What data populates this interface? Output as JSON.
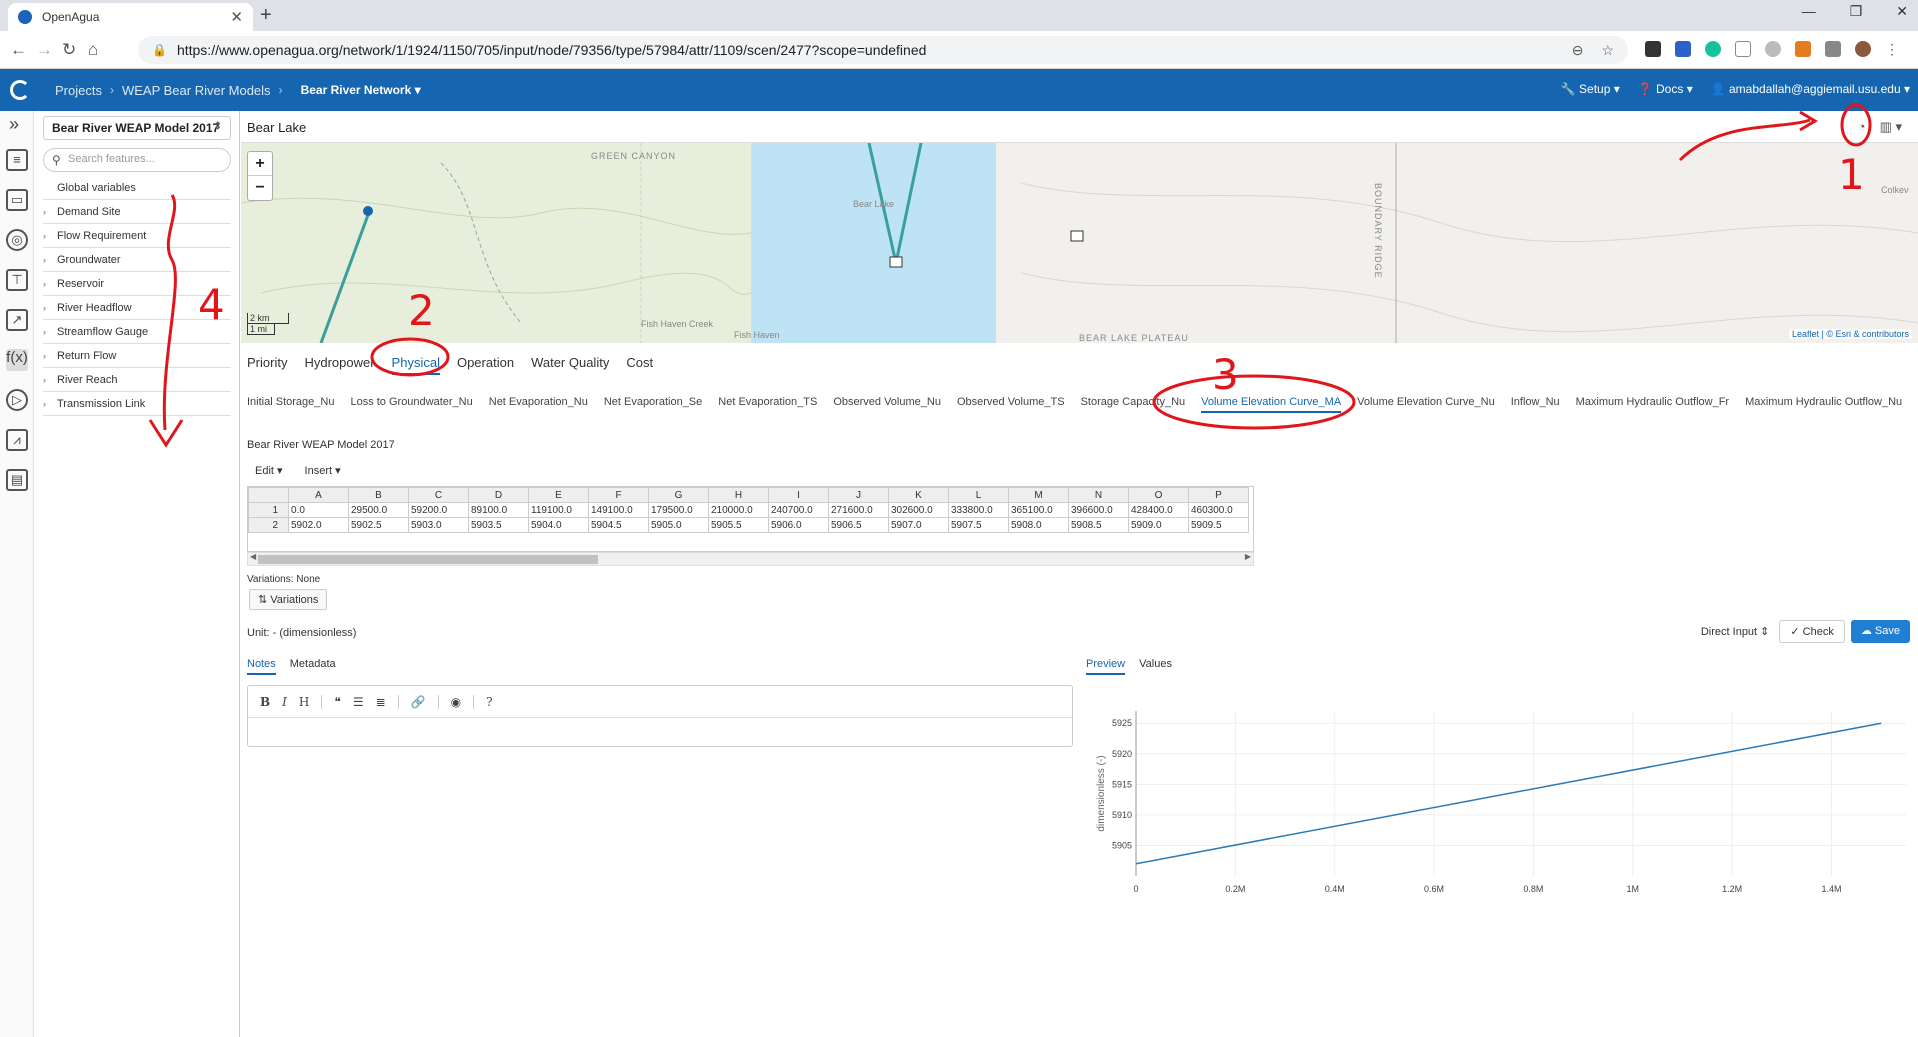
{
  "browser": {
    "tab_title": "OpenAgua",
    "url": "https://www.openagua.org/network/1/1924/1150/705/input/node/79356/type/57984/attr/1109/scen/2477?scope=undefined"
  },
  "header": {
    "crumbs": [
      "Projects",
      "WEAP Bear River Models"
    ],
    "active": "Bear River Network",
    "setup": "Setup",
    "docs": "Docs",
    "user": "amabdallah@aggiemail.usu.edu"
  },
  "features": {
    "model": "Bear River WEAP Model 2017",
    "search_placeholder": "Search features...",
    "items": [
      "Global variables",
      "Demand Site",
      "Flow Requirement",
      "Groundwater",
      "Reservoir",
      "River Headflow",
      "Streamflow Gauge",
      "Return Flow",
      "River Reach",
      "Transmission Link"
    ]
  },
  "main": {
    "title": "Bear Lake",
    "map": {
      "labels": [
        "GREEN CANYON",
        "Bear Lake",
        "Fish Haven",
        "Fish Haven Creek",
        "BEAR LAKE PLATEAU",
        "BOUNDARY RIDGE",
        "Colkev"
      ],
      "scale_km": "2 km",
      "scale_mi": "1 mi",
      "attribution": "Leaflet | © Esri & contributors"
    },
    "tabs": [
      "Priority",
      "Hydropower",
      "Physical",
      "Operation",
      "Water Quality",
      "Cost"
    ],
    "active_tab": "Physical",
    "attributes": [
      "Initial Storage_Nu",
      "Loss to Groundwater_Nu",
      "Net Evaporation_Nu",
      "Net Evaporation_Se",
      "Net Evaporation_TS",
      "Observed Volume_Nu",
      "Observed Volume_TS",
      "Storage Capacity_Nu",
      "Volume Elevation Curve_MA",
      "Volume Elevation Curve_Nu",
      "Inflow_Nu",
      "Maximum Hydraulic Outflow_Fr",
      "Maximum Hydraulic Outflow_Nu"
    ],
    "active_attribute": "Volume Elevation Curve_MA",
    "scenario": "Bear River WEAP Model 2017",
    "edit": "Edit",
    "insert": "Insert",
    "grid": {
      "columns": [
        "A",
        "B",
        "C",
        "D",
        "E",
        "F",
        "G",
        "H",
        "I",
        "J",
        "K",
        "L",
        "M",
        "N",
        "O",
        "P"
      ],
      "rows": [
        {
          "n": "1",
          "cells": [
            "0.0",
            "29500.0",
            "59200.0",
            "89100.0",
            "119100.0",
            "149100.0",
            "179500.0",
            "210000.0",
            "240700.0",
            "271600.0",
            "302600.0",
            "333800.0",
            "365100.0",
            "396600.0",
            "428400.0",
            "460300.0"
          ]
        },
        {
          "n": "2",
          "cells": [
            "5902.0",
            "5902.5",
            "5903.0",
            "5903.5",
            "5904.0",
            "5904.5",
            "5905.0",
            "5905.5",
            "5906.0",
            "5906.5",
            "5907.0",
            "5907.5",
            "5908.0",
            "5908.5",
            "5909.0",
            "5909.5"
          ]
        }
      ]
    },
    "variations_label": "Variations: None",
    "variations_button": "Variations",
    "unit": "Unit: -  (dimensionless)",
    "direct_input": "Direct Input",
    "check": "Check",
    "save": "Save",
    "note_tabs": [
      "Notes",
      "Metadata"
    ],
    "preview_tabs": [
      "Preview",
      "Values"
    ]
  },
  "annotations": [
    "1",
    "2",
    "3",
    "4"
  ],
  "colors": {
    "header": "#1565b0",
    "accent": "#1e7fd4",
    "annotation": "#e0161b",
    "lake": "#bde3f5",
    "line": "#2a7ab8"
  },
  "chart_data": {
    "type": "line",
    "ylabel": "dimensionless (-)",
    "x": [
      0,
      1500000
    ],
    "y": [
      5902.0,
      5925.0
    ],
    "xticks": [
      "0",
      "0.2M",
      "0.4M",
      "0.6M",
      "0.8M",
      "1M",
      "1.2M",
      "1.4M"
    ],
    "yticks": [
      "5905",
      "5910",
      "5915",
      "5920",
      "5925"
    ],
    "xlim": [
      0,
      1550000
    ],
    "ylim": [
      5900,
      5927
    ]
  }
}
